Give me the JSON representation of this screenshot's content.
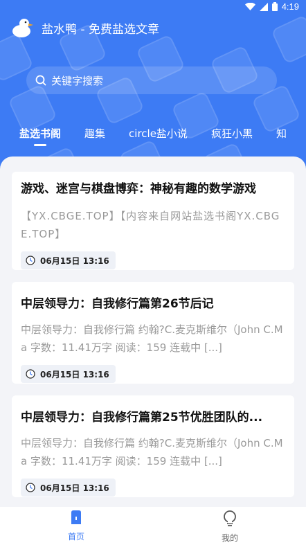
{
  "status_bar": {
    "time": "4:19"
  },
  "app": {
    "title": "盐水鸭 - 免费盐选文章"
  },
  "search": {
    "placeholder": "关键字搜索"
  },
  "tabs": [
    {
      "label": "盐选书阁",
      "active": true
    },
    {
      "label": "趣集"
    },
    {
      "label": "circle盐小说"
    },
    {
      "label": "疯狂小黑"
    },
    {
      "label": "知"
    }
  ],
  "articles": [
    {
      "title": "游戏、迷宫与棋盘博弈：神秘有趣的数学游戏",
      "description": "【YX.CBGE.TOP】【内容来自网站盐选书阁YX.CBGE.TOP】",
      "date": "06月15日 13:16"
    },
    {
      "title": "中层领导力：自我修行篇第26节后记",
      "description": "中层领导力：自我修行篇 约翰?C.麦克斯维尔（John C.Ma 字数：11.41万字 阅读：159 连载中 [...]",
      "date": "06月15日 13:16"
    },
    {
      "title": "中层领导力：自我修行篇第25节优胜团队的...",
      "description": "中层领导力：自我修行篇 约翰?C.麦克斯维尔（John C.Ma 字数：11.41万字 阅读：159 连载中 [...]",
      "date": "06月15日 13:16"
    }
  ],
  "bottom_nav": [
    {
      "label": "首页",
      "active": true,
      "icon": "home-icon"
    },
    {
      "label": "我的",
      "icon": "profile-icon"
    }
  ],
  "colors": {
    "primary": "#3d7bf4",
    "background": "#f3f4f8"
  }
}
